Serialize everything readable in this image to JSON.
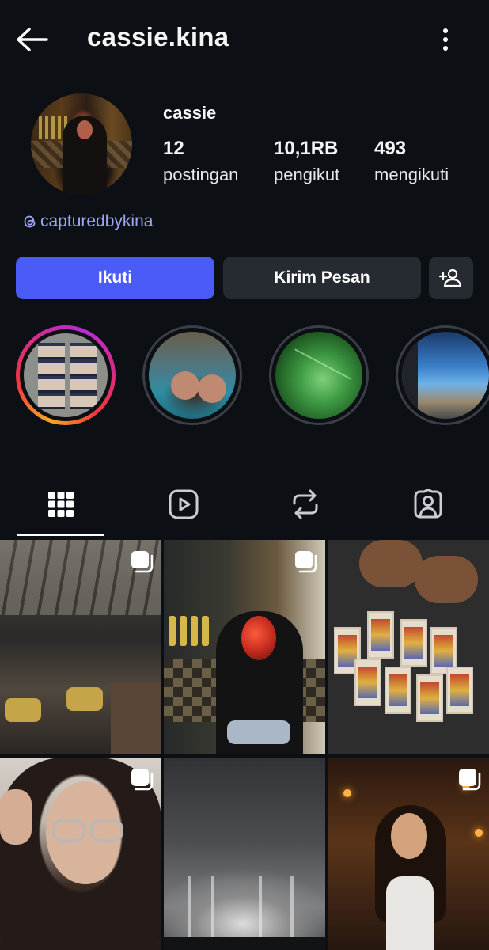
{
  "header": {
    "back_icon": "arrow-left-icon",
    "username": "cassie.kina",
    "more_icon": "more-vertical-icon"
  },
  "profile": {
    "display_name": "cassie",
    "stats": [
      {
        "value": "12",
        "label": "postingan"
      },
      {
        "value": "10,1RB",
        "label": "pengikut"
      },
      {
        "value": "493",
        "label": "mengikuti"
      }
    ],
    "threads_icon": "threads-icon",
    "threads_handle": "capturedbykina"
  },
  "actions": {
    "follow_label": "Ikuti",
    "message_label": "Kirim Pesan",
    "suggest_icon": "add-person-icon"
  },
  "colors": {
    "background": "#0c0f14",
    "follow_button": "#4a5bf8",
    "secondary_button": "#262a31",
    "link": "#9fa6f8"
  },
  "highlights": [
    {
      "ring": "story-gradient",
      "subject": "photo-strip"
    },
    {
      "ring": "plain",
      "subject": "pool"
    },
    {
      "ring": "plain",
      "subject": "green-glass"
    },
    {
      "ring": "plain",
      "subject": "window-view"
    }
  ],
  "tabs": [
    {
      "icon": "grid-icon",
      "active": true
    },
    {
      "icon": "reels-icon",
      "active": false
    },
    {
      "icon": "repost-icon",
      "active": false
    },
    {
      "icon": "tagged-icon",
      "active": false
    }
  ],
  "posts": [
    {
      "subject": "restaurant-interior",
      "multi": true
    },
    {
      "subject": "girl-red-light",
      "multi": true
    },
    {
      "subject": "tarot-cards",
      "multi": false
    },
    {
      "subject": "selfie-glasses",
      "multi": true
    },
    {
      "subject": "concert-stage",
      "multi": false
    },
    {
      "subject": "girl-restaurant",
      "multi": true
    }
  ]
}
